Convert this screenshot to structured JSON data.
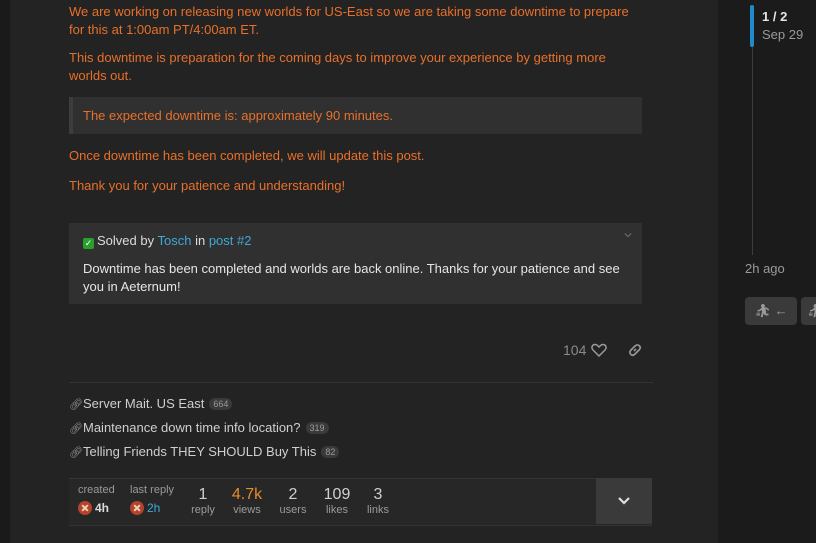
{
  "post": {
    "paragraph1": "We are working on releasing new worlds for US-East so we are taking some downtime to prepare for this at 1:00am PT/4:00am ET.",
    "paragraph2": "This downtime is preparation for the coming days to improve your experience by getting more worlds out.",
    "quote": "The expected downtime is: approximately 90 minutes.",
    "paragraph3": "Once downtime has been completed, we will update this post.",
    "paragraph4": "Thank you for your patience and understanding!"
  },
  "solved": {
    "prefix": "Solved by",
    "author": "Tosch",
    "in": "in",
    "post_link": "post #2",
    "body": "Downtime has been completed and worlds are back online. Thanks for your patience and see you in Aeternum!"
  },
  "actions": {
    "likes": "104"
  },
  "related": [
    {
      "title": "Server Mait. US East",
      "count": "664"
    },
    {
      "title": "Maintenance down time info location?",
      "count": "319"
    },
    {
      "title": "Telling Friends THEY SHOULD Buy This",
      "count": "82"
    }
  ],
  "topic_map": {
    "created_label": "created",
    "created_time": "4h",
    "last_reply_label": "last reply",
    "last_reply_time": "2h",
    "replies": "1",
    "replies_label": "reply",
    "views": "4.7k",
    "views_label": "views",
    "users": "2",
    "users_label": "users",
    "likes": "109",
    "likes_label": "likes",
    "links": "3",
    "links_label": "links"
  },
  "timeline": {
    "position": "1 / 2",
    "date": "Sep 29",
    "ago": "2h ago",
    "back_arrow": "←"
  },
  "colors": {
    "accent_orange": "#e8702a",
    "link_blue": "#3ea8d8",
    "timeline_blue": "#1f8cc9",
    "solved_green": "#27a02c"
  },
  "icons": [
    "check-icon",
    "chevron-down-icon",
    "heart-icon",
    "link-icon",
    "chain-icon",
    "avatar-icon",
    "expand-chevron-icon",
    "back-arrow-icon"
  ]
}
